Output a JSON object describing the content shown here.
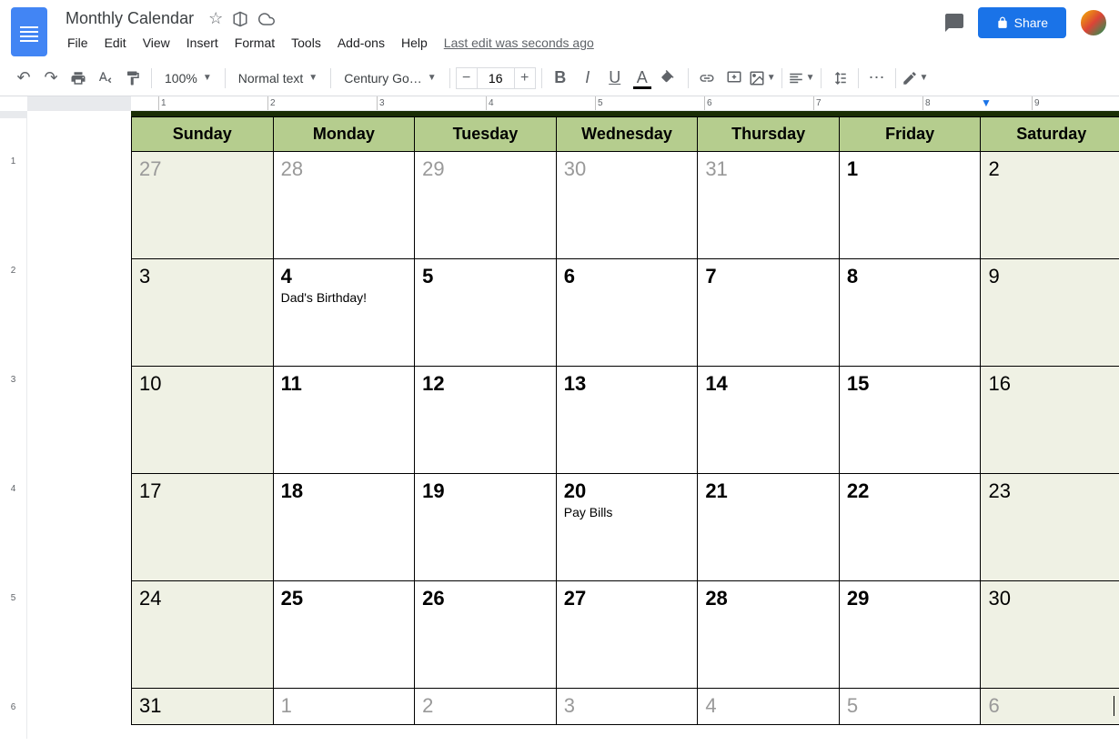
{
  "doc": {
    "title": "Monthly Calendar"
  },
  "menu": {
    "file": "File",
    "edit": "Edit",
    "view": "View",
    "insert": "Insert",
    "format": "Format",
    "tools": "Tools",
    "addons": "Add-ons",
    "help": "Help",
    "last_edit": "Last edit was seconds ago"
  },
  "share": {
    "label": "Share"
  },
  "toolbar": {
    "zoom": "100%",
    "style": "Normal text",
    "font": "Century Go…",
    "font_size": "16"
  },
  "calendar": {
    "headers": [
      "Sunday",
      "Monday",
      "Tuesday",
      "Wednesday",
      "Thursday",
      "Friday",
      "Saturday"
    ],
    "weeks": [
      [
        {
          "n": "27",
          "other": true,
          "we": true
        },
        {
          "n": "28",
          "other": true
        },
        {
          "n": "29",
          "other": true
        },
        {
          "n": "30",
          "other": true
        },
        {
          "n": "31",
          "other": true
        },
        {
          "n": "1"
        },
        {
          "n": "2",
          "we": true
        }
      ],
      [
        {
          "n": "3",
          "we": true
        },
        {
          "n": "4",
          "event": "Dad's Birthday!"
        },
        {
          "n": "5"
        },
        {
          "n": "6"
        },
        {
          "n": "7"
        },
        {
          "n": "8"
        },
        {
          "n": "9",
          "we": true
        }
      ],
      [
        {
          "n": "10",
          "we": true
        },
        {
          "n": "11"
        },
        {
          "n": "12"
        },
        {
          "n": "13"
        },
        {
          "n": "14"
        },
        {
          "n": "15"
        },
        {
          "n": "16",
          "we": true
        }
      ],
      [
        {
          "n": "17",
          "we": true
        },
        {
          "n": "18"
        },
        {
          "n": "19"
        },
        {
          "n": "20",
          "event": "Pay Bills"
        },
        {
          "n": "21"
        },
        {
          "n": "22"
        },
        {
          "n": "23",
          "we": true
        }
      ],
      [
        {
          "n": "24",
          "we": true
        },
        {
          "n": "25"
        },
        {
          "n": "26"
        },
        {
          "n": "27"
        },
        {
          "n": "28"
        },
        {
          "n": "29"
        },
        {
          "n": "30",
          "we": true
        }
      ],
      [
        {
          "n": "31",
          "we": true
        },
        {
          "n": "1",
          "other": true
        },
        {
          "n": "2",
          "other": true
        },
        {
          "n": "3",
          "other": true
        },
        {
          "n": "4",
          "other": true
        },
        {
          "n": "5",
          "other": true
        },
        {
          "n": "6",
          "other": true,
          "we": true,
          "cursor": true
        }
      ]
    ]
  },
  "ruler_h": [
    "1",
    "2",
    "3",
    "4",
    "5",
    "6",
    "7",
    "8",
    "9"
  ],
  "ruler_v": [
    "1",
    "2",
    "3",
    "4",
    "5",
    "6"
  ]
}
